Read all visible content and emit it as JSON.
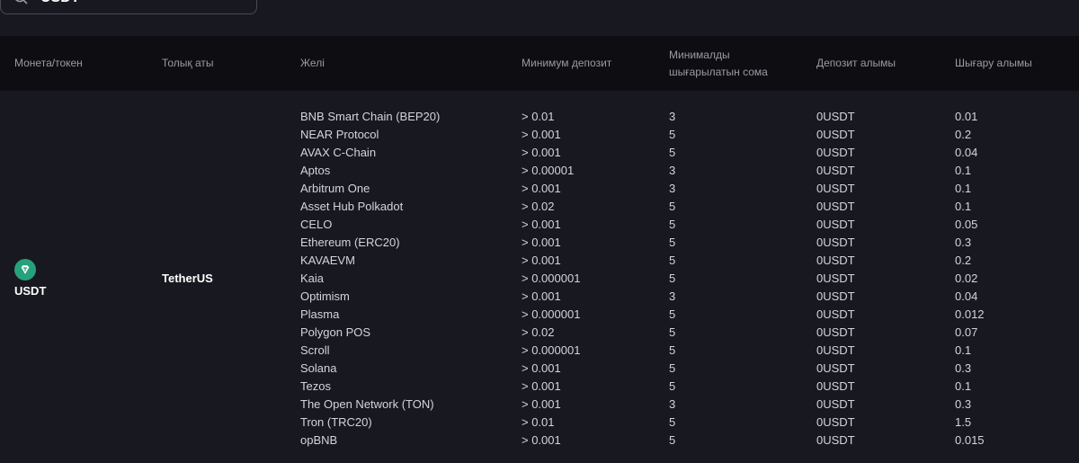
{
  "search": {
    "value": "USDT"
  },
  "header": {
    "coin": "Монета/токен",
    "fullname": "Толық аты",
    "network": "Желі",
    "min_deposit": "Минимум депозит",
    "min_withdraw": "Минималды шығарылатын сома",
    "deposit_fee": "Депозит алымы",
    "withdraw_fee": "Шығару алымы"
  },
  "coin": {
    "symbol": "USDT",
    "fullname": "TetherUS",
    "icon": "tether-icon",
    "icon_color": "#26a17b"
  },
  "rows": [
    {
      "network": "BNB Smart Chain (BEP20)",
      "min_deposit": "> 0.01",
      "min_withdraw": "3",
      "deposit_fee": "0USDT",
      "withdraw_fee": "0.01"
    },
    {
      "network": "NEAR Protocol",
      "min_deposit": "> 0.001",
      "min_withdraw": "5",
      "deposit_fee": "0USDT",
      "withdraw_fee": "0.2"
    },
    {
      "network": "AVAX C-Chain",
      "min_deposit": "> 0.001",
      "min_withdraw": "5",
      "deposit_fee": "0USDT",
      "withdraw_fee": "0.04"
    },
    {
      "network": "Aptos",
      "min_deposit": "> 0.00001",
      "min_withdraw": "3",
      "deposit_fee": "0USDT",
      "withdraw_fee": "0.1"
    },
    {
      "network": "Arbitrum One",
      "min_deposit": "> 0.001",
      "min_withdraw": "3",
      "deposit_fee": "0USDT",
      "withdraw_fee": "0.1"
    },
    {
      "network": "Asset Hub Polkadot",
      "min_deposit": "> 0.02",
      "min_withdraw": "5",
      "deposit_fee": "0USDT",
      "withdraw_fee": "0.1"
    },
    {
      "network": "CELO",
      "min_deposit": "> 0.001",
      "min_withdraw": "5",
      "deposit_fee": "0USDT",
      "withdraw_fee": "0.05"
    },
    {
      "network": "Ethereum (ERC20)",
      "min_deposit": "> 0.001",
      "min_withdraw": "5",
      "deposit_fee": "0USDT",
      "withdraw_fee": "0.3"
    },
    {
      "network": "KAVAEVM",
      "min_deposit": "> 0.001",
      "min_withdraw": "5",
      "deposit_fee": "0USDT",
      "withdraw_fee": "0.2"
    },
    {
      "network": "Kaia",
      "min_deposit": "> 0.000001",
      "min_withdraw": "5",
      "deposit_fee": "0USDT",
      "withdraw_fee": "0.02"
    },
    {
      "network": "Optimism",
      "min_deposit": "> 0.001",
      "min_withdraw": "3",
      "deposit_fee": "0USDT",
      "withdraw_fee": "0.04"
    },
    {
      "network": "Plasma",
      "min_deposit": "> 0.000001",
      "min_withdraw": "5",
      "deposit_fee": "0USDT",
      "withdraw_fee": "0.012"
    },
    {
      "network": "Polygon POS",
      "min_deposit": "> 0.02",
      "min_withdraw": "5",
      "deposit_fee": "0USDT",
      "withdraw_fee": "0.07"
    },
    {
      "network": "Scroll",
      "min_deposit": "> 0.000001",
      "min_withdraw": "5",
      "deposit_fee": "0USDT",
      "withdraw_fee": "0.1"
    },
    {
      "network": "Solana",
      "min_deposit": "> 0.001",
      "min_withdraw": "5",
      "deposit_fee": "0USDT",
      "withdraw_fee": "0.3"
    },
    {
      "network": "Tezos",
      "min_deposit": "> 0.001",
      "min_withdraw": "5",
      "deposit_fee": "0USDT",
      "withdraw_fee": "0.1"
    },
    {
      "network": "The Open Network (TON)",
      "min_deposit": "> 0.001",
      "min_withdraw": "3",
      "deposit_fee": "0USDT",
      "withdraw_fee": "0.3"
    },
    {
      "network": "Tron (TRC20)",
      "min_deposit": "> 0.01",
      "min_withdraw": "5",
      "deposit_fee": "0USDT",
      "withdraw_fee": "1.5"
    },
    {
      "network": "opBNB",
      "min_deposit": "> 0.001",
      "min_withdraw": "5",
      "deposit_fee": "0USDT",
      "withdraw_fee": "0.015"
    }
  ]
}
